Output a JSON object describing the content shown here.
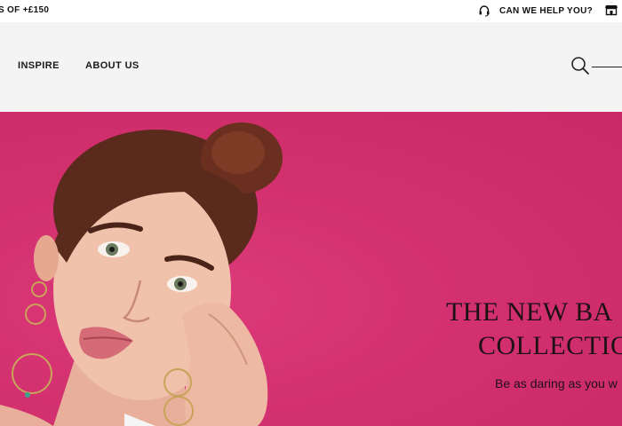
{
  "topbar": {
    "promo_text": "S OF +£150",
    "help_label": "CAN WE HELP YOU?",
    "help_icon": "headset-icon",
    "store_icon": "store-icon"
  },
  "nav": {
    "items": [
      {
        "label": "INSPIRE"
      },
      {
        "label": "ABOUT US"
      }
    ],
    "search_icon": "search-icon"
  },
  "hero": {
    "title_line1": "THE NEW BA",
    "title_line2": "COLLECTIO",
    "subtitle": "Be as daring as you w",
    "background_color": "#d3306f"
  }
}
